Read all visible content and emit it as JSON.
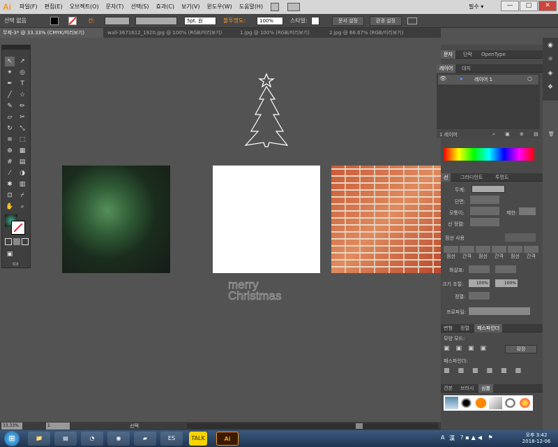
{
  "app": {
    "logo": "Ai"
  },
  "menu": [
    "파일(F)",
    "편집(E)",
    "오브젝트(O)",
    "문자(T)",
    "선택(S)",
    "효과(C)",
    "보기(V)",
    "윈도우(W)",
    "도움말(H)"
  ],
  "workspace": "필수 ▾",
  "window_controls": {
    "minimize": "—",
    "restore": "□",
    "close": "✕"
  },
  "control": {
    "selection": "선택 없음",
    "stroke_label": "선:",
    "profile": "5pt. 원",
    "opacity_label": "불투명도:",
    "opacity": "100%",
    "style_label": "스타일:",
    "doc_setup": "문서 설정",
    "prefs": "환경 설정"
  },
  "doc_tabs": [
    "무제-3* @ 33.33% (CMYK/미리보기)",
    "wall-3671612_1920.jpg @ 100% (RGB/미리보기)",
    "1.jpg @ 100% (RGB/미리보기)",
    "2.jpg @ 66.67% (RGB/미리보기)"
  ],
  "artwork": {
    "text_line1": "merry",
    "text_line2": "Christmas"
  },
  "panels": {
    "type_tabs": [
      "문자",
      "단락",
      "OpenType"
    ],
    "layer_tabs": [
      "레이어",
      "대지"
    ],
    "layer_name": "레이어 1",
    "layer_count": "1 레이어",
    "stroke_tabs": [
      "선",
      "그라디언트",
      "투명도"
    ],
    "stroke": {
      "weight": "두께:",
      "cap": "단면:",
      "corner": "모퉁이:",
      "limit": "제한:",
      "align": "선 정렬:",
      "dashed": "점선 사용",
      "dash_labels": [
        "점선",
        "간격",
        "점선",
        "간격",
        "점선",
        "간격"
      ],
      "arrow": "화살표:",
      "scale": "크기 조절:",
      "scale_v1": "100%",
      "scale_v2": "100%",
      "align2": "정렬:",
      "profile": "프로파일:"
    },
    "pathfinder_tabs": [
      "변형",
      "정렬",
      "패스파인더"
    ],
    "pathfinder": {
      "shape_modes": "모양 모드:",
      "expand": "확장",
      "pathfinders": "패스파인더:"
    },
    "symbol_tabs": [
      "견본",
      "브러시",
      "심볼"
    ]
  },
  "status": {
    "zoom": "33.33%",
    "page": "1",
    "tool": "선택"
  },
  "clock": {
    "time": "오후 3:42",
    "date": "2018-12-06"
  },
  "tray": {
    "lang": "A",
    "ime": "漢"
  },
  "taskbar_apps": [
    "explorer",
    "doc",
    "chrome-old",
    "chrome",
    "folder",
    "ES",
    "TALK",
    "Ai"
  ],
  "icons": {
    "start": "windows-icon"
  }
}
